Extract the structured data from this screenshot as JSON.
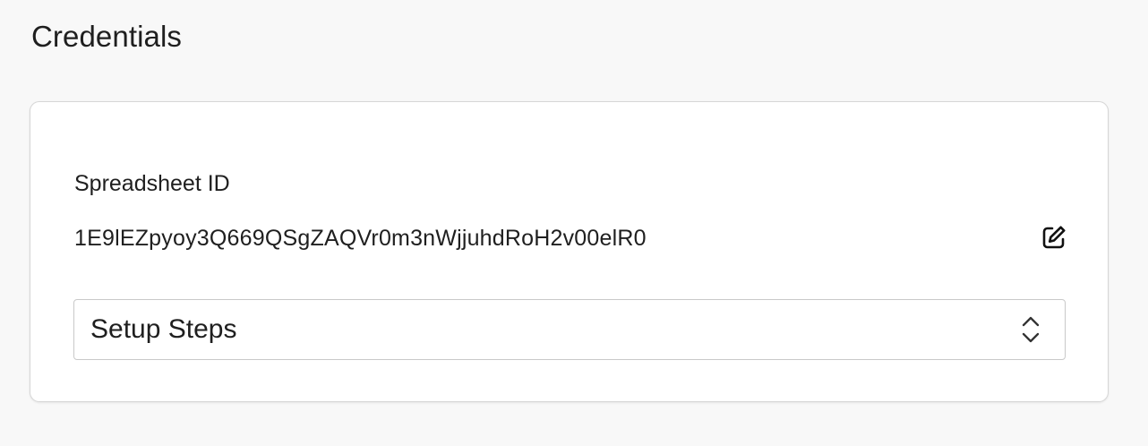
{
  "section": {
    "title": "Credentials"
  },
  "credentials_card": {
    "field_label": "Spreadsheet ID",
    "spreadsheet_id": "1E9lEZpyoy3Q669QSgZAQVr0m3nWjjuhdRoH2v00elR0",
    "edit_icon": "edit-icon",
    "setup_select": {
      "selected": "Setup Steps",
      "icon": "chevron-up-down-icon"
    }
  }
}
